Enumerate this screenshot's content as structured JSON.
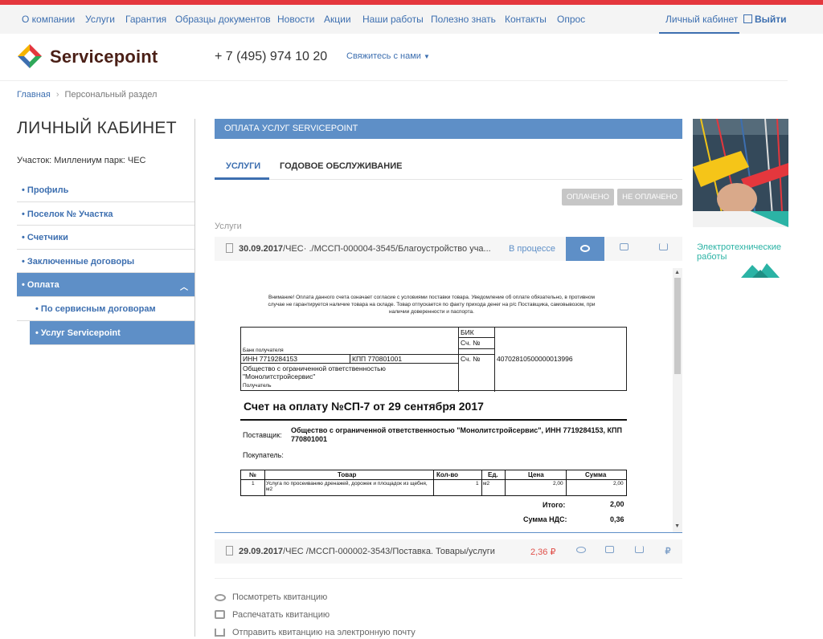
{
  "topnav": {
    "items": [
      "О компании",
      "Услуги",
      "Гарантия",
      "Образцы документов",
      "Новости",
      "Акции",
      "Наши работы",
      "Полезно знать",
      "Контакты",
      "Опрос"
    ],
    "account": "Личный кабинет",
    "logout": "Выйти"
  },
  "header": {
    "brand": "Servicepoint",
    "phone": "+ 7 (495) 974 10 20",
    "contact": "Свяжитесь с нами"
  },
  "breadcrumb": [
    "Главная",
    "Персональный раздел"
  ],
  "sidebar": {
    "title": "ЛИЧНЫЙ КАБИНЕТ",
    "plot": "Участок: Миллениум парк: ЧЕС",
    "items": [
      {
        "label": "• Профиль"
      },
      {
        "label": "• Поселок № Участка"
      },
      {
        "label": "• Счетчики"
      },
      {
        "label": "• Заключенные договоры"
      },
      {
        "label": "• Оплата"
      }
    ],
    "subitems": [
      {
        "label": "• По сервисным договорам"
      },
      {
        "label": "• Услуг Servicepoint"
      }
    ]
  },
  "main": {
    "panel_title": "ОПЛАТА УСЛУГ SERVICEPOINT",
    "tabs": [
      "УСЛУГИ",
      "ГОДОВОЕ ОБСЛУЖИВАНИЕ"
    ],
    "filters": [
      "ОПЛАЧЕНО",
      "НЕ ОПЛАЧЕНО"
    ],
    "section": "Услуги",
    "rows": [
      {
        "date": "30.09.2017",
        "text": "/ЧЕС·          ./МССП-000004-3545/Благоустройство уча...",
        "status": "В процессе"
      },
      {
        "date": "29.09.2017",
        "text": "/ЧЕС          /МССП-000002-3543/Поставка. Товары/услуги",
        "amount": "2,36 ₽"
      }
    ]
  },
  "invoice": {
    "notice": "Внимание! Оплата данного счета означает согласие с условиями поставки товара. Уведомление об оплате обязательно, в противном случае не гарантируется наличие товара на складе. Товар отпускается по факту прихода денег на р/с Поставщика, самовывозом, при наличии доверенности и паспорта.",
    "bank_label": "Банк получателя",
    "bik_label": "БИК",
    "account_label": "Сч. №",
    "inn": "ИНН   7719284153",
    "kpp": "КПП   770801001",
    "account_no": "40702810500000013996",
    "recipient_name": "Общество с ограниченной ответственностью \"Монолитстройсервис\"",
    "recipient_label": "Получатель",
    "title": "Счет на оплату №СП-7 от 29 сентября 2017",
    "supplier_label": "Поставщик:",
    "supplier": "Общество с ограниченной ответственностью \"Монолитстройсервис\", ИНН 7719284153, КПП 770801001",
    "buyer_label": "Покупатель:",
    "table_headers": [
      "№",
      "Товар",
      "Кол-во",
      "Ед.",
      "Цена",
      "Сумма"
    ],
    "table_row": {
      "n": "1",
      "item": "Услуга по просеиванию дренажей, дорожек и площадок из щебня, м2",
      "qty": "1",
      "unit": "м2",
      "price": "2,00",
      "sum": "2,00"
    },
    "total_label": "Итого:",
    "total": "2,00",
    "vat_label": "Сумма НДС:",
    "vat": "0,36"
  },
  "actions": [
    "Посмотреть квитанцию",
    "Распечатать квитанцию",
    "Отправить квитанцию на электронную почту"
  ],
  "ad": {
    "caption_line1": "Электротехнические",
    "caption_line2": "работы"
  }
}
